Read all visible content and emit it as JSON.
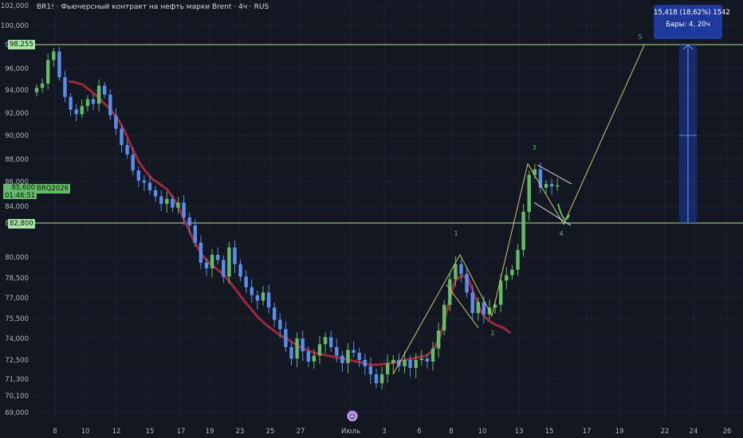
{
  "header": {
    "title": "BR1! · Фьючерсный контракт на нефть марки Brent · 4ч · RUS"
  },
  "measure": {
    "line1": "15,418 (18,62%) 1542",
    "line2": "Бары: 4, 20ч"
  },
  "price_tags": {
    "level_high": "98,255",
    "level_low": "82,800",
    "current_price": "85,600",
    "countdown": "01:46:51",
    "symbol": "BRQ2026"
  },
  "wave_labels": [
    "1",
    "2",
    "3",
    "4",
    "5"
  ],
  "colors": {
    "background": "#131722",
    "grid": "#1e222d",
    "bull": "#66bb6a",
    "bear": "#5b8def",
    "ma": "#9c2a3a",
    "wave": "#c8c86a",
    "level": "#b8e68a",
    "measure": "#1e3a9c"
  },
  "icons": {
    "date_nav": "calendar-arrow-icon"
  },
  "chart_data": {
    "type": "candlestick",
    "title": "BR1! · Фьючерсный контракт на нефть марки Brent · 4ч · RUS",
    "ylim": [
      68000,
      102000
    ],
    "yticks": [
      "69,000",
      "70,100",
      "71,300",
      "72,500",
      "74,000",
      "75,500",
      "77,000",
      "78,500",
      "80,000",
      "82,800",
      "84,000",
      "86,000",
      "88,000",
      "90,000",
      "92,000",
      "94,000",
      "96,000",
      "98,255",
      "100,000",
      "102,000"
    ],
    "ytick_values": [
      69000,
      70100,
      71300,
      72500,
      74000,
      75500,
      77000,
      78500,
      80000,
      82800,
      84000,
      86000,
      88000,
      90000,
      92000,
      94000,
      96000,
      98255,
      100000,
      102000
    ],
    "xticks": [
      "8",
      "10",
      "12",
      "15",
      "17",
      "19",
      "23",
      "25",
      "27",
      "Июль",
      "3",
      "6",
      "8",
      "10",
      "13",
      "15",
      "17",
      "19",
      "22",
      "24",
      "26"
    ],
    "grid": true,
    "horizontal_levels": [
      98255,
      82800
    ],
    "current_price": 85600,
    "closes": [
      94200,
      94600,
      96800,
      97600,
      95200,
      93400,
      92300,
      91900,
      92600,
      93200,
      92800,
      94400,
      93600,
      91800,
      90600,
      89200,
      88400,
      87000,
      86100,
      85900,
      85300,
      84800,
      84200,
      84600,
      83900,
      84300,
      83200,
      82600,
      81200,
      79600,
      79200,
      80200,
      79800,
      78600,
      80800,
      79500,
      78600,
      77800,
      77200,
      76800,
      77400,
      76300,
      75400,
      74700,
      73400,
      72600,
      74000,
      73100,
      72400,
      72800,
      73600,
      74100,
      73400,
      72800,
      72300,
      73200,
      73000,
      72500,
      72100,
      71600,
      71000,
      71600,
      72300,
      72500,
      72100,
      72500,
      72000,
      72500,
      72600,
      72400,
      73300,
      74600,
      76500,
      78400,
      79500,
      78800,
      77400,
      75900,
      76700,
      75800,
      76300,
      76500,
      78300,
      78700,
      79100,
      80600,
      83600,
      86600,
      87100,
      85500,
      85800,
      85600,
      85700
    ],
    "moving_average": [
      94800,
      94700,
      94500,
      94000,
      93500,
      92900,
      92300,
      91500,
      90400,
      89000,
      87800,
      86900,
      86200,
      85800,
      85400,
      84600,
      83600,
      82400,
      81200,
      80200,
      79600,
      79200,
      78800,
      78200,
      77500,
      76800,
      76200,
      75600,
      75100,
      74700,
      74300,
      74000,
      73700,
      73400,
      73200,
      73000,
      72900,
      72800,
      72700,
      72600,
      72500,
      72400,
      72300,
      72200,
      72200,
      72250,
      72300,
      72400,
      72500,
      72600,
      72700,
      72800,
      73200,
      74200,
      76200,
      78200,
      78700,
      78400,
      77000,
      75800,
      75300,
      75000,
      74800,
      74400
    ],
    "waves": [
      {
        "label": "1",
        "date": "8"
      },
      {
        "label": "2",
        "date": "10"
      },
      {
        "label": "3",
        "date": "15"
      },
      {
        "label": "4",
        "date": "15"
      },
      {
        "label": "5",
        "date": "19"
      }
    ],
    "measurement": {
      "change": 15418,
      "change_pct": 18.62,
      "ticks": 1542,
      "bars": "4, 20ч"
    }
  }
}
